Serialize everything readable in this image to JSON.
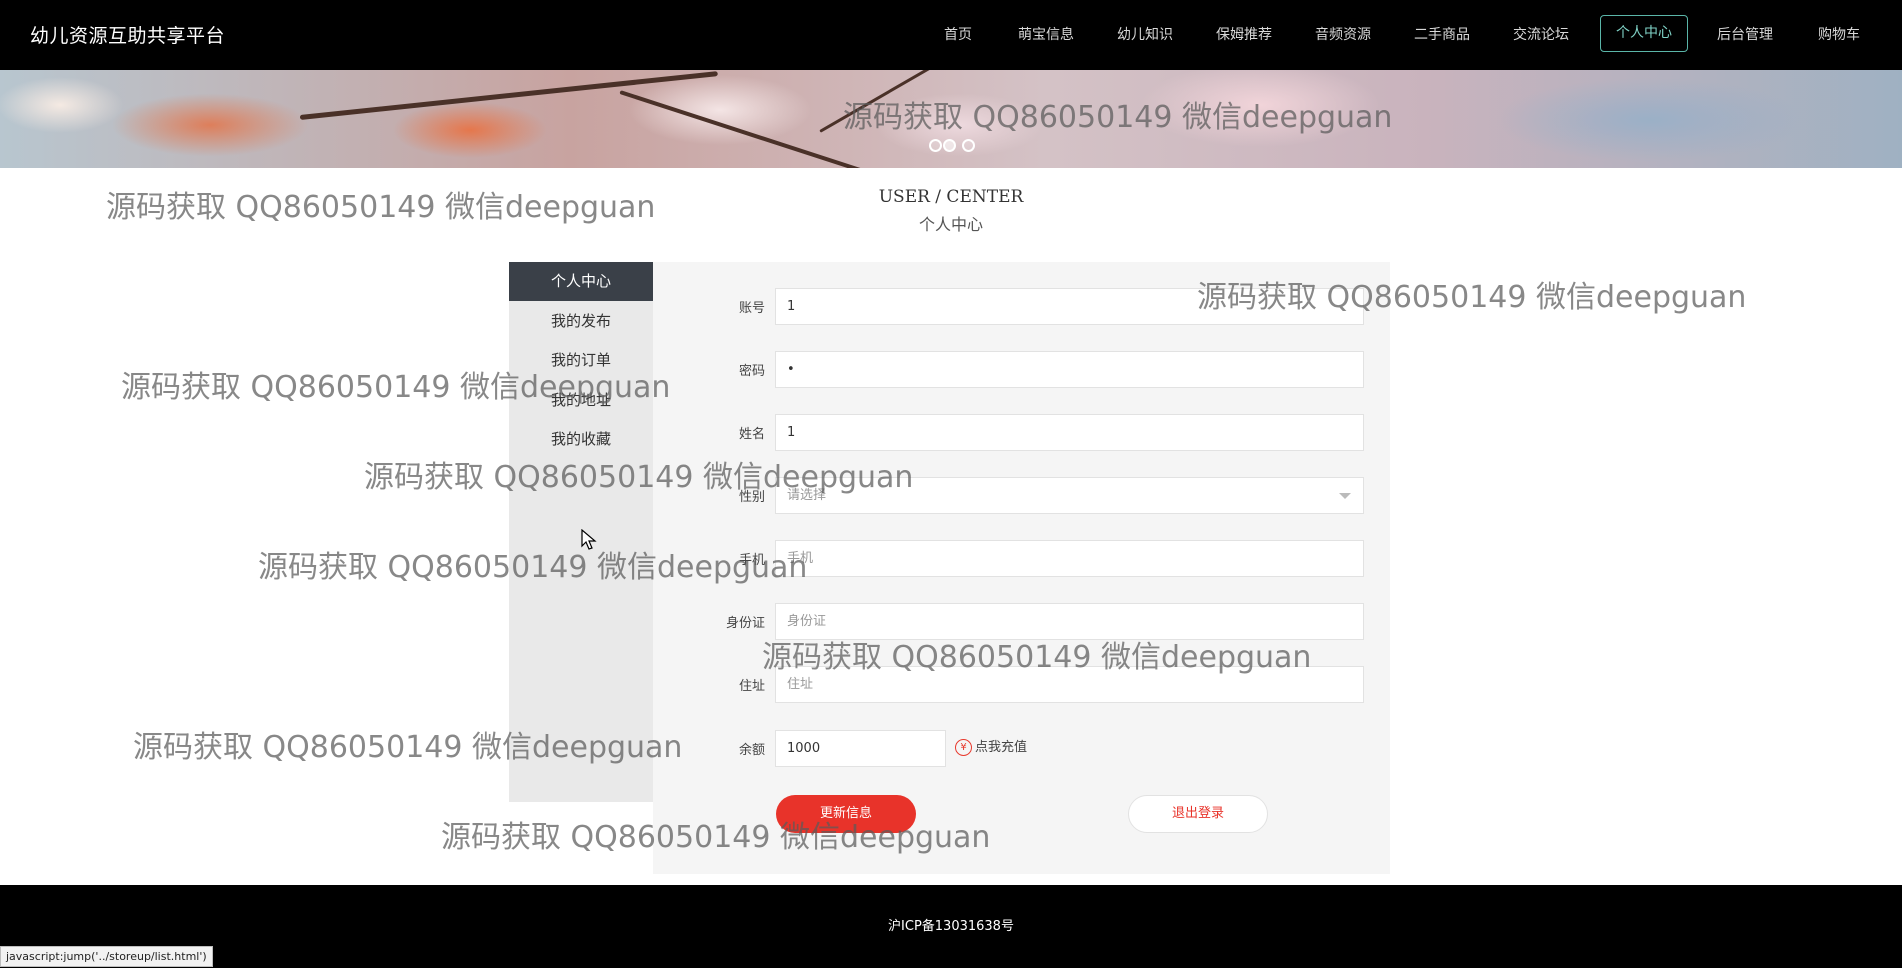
{
  "brand": "幼儿资源互助共享平台",
  "nav": {
    "items": [
      "首页",
      "萌宝信息",
      "幼儿知识",
      "保姆推荐",
      "音频资源",
      "二手商品",
      "交流论坛",
      "个人中心",
      "后台管理",
      "购物车"
    ],
    "active_index": 7
  },
  "banner": {
    "dot_count": 3,
    "active_dot": 1
  },
  "section": {
    "title_en": "USER / CENTER",
    "title_cn": "个人中心"
  },
  "sidebar": {
    "items": [
      "个人中心",
      "我的发布",
      "我的订单",
      "我的地址",
      "我的收藏"
    ],
    "active_index": 0
  },
  "form": {
    "account": {
      "label": "账号",
      "value": "1"
    },
    "password": {
      "label": "密码",
      "value": "1"
    },
    "name": {
      "label": "姓名",
      "value": "1"
    },
    "gender": {
      "label": "性别",
      "placeholder": "请选择"
    },
    "phone": {
      "label": "手机",
      "placeholder": "手机"
    },
    "id_card": {
      "label": "身份证",
      "placeholder": "身份证"
    },
    "address": {
      "label": "住址",
      "placeholder": "住址"
    },
    "balance": {
      "label": "余额",
      "value": "1000"
    },
    "recharge_label": "点我充值",
    "update_button": "更新信息",
    "logout_button": "退出登录"
  },
  "footer": {
    "icp": "沪ICP备13031638号"
  },
  "status_bar": "javascript:jump('../storeup/list.html')",
  "watermark": "源码获取 QQ86050149 微信deepguan",
  "colors": {
    "nav_bg": "#000000",
    "accent_teal": "#5ab5a8",
    "accent_red": "#e8332a",
    "sidebar_active": "#3a4048"
  }
}
